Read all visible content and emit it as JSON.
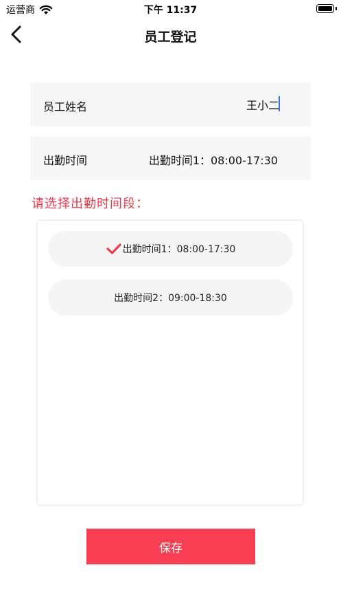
{
  "status_bar": {
    "carrier": "运营商",
    "time": "下午 11:37",
    "wifi_icon": "wifi-icon",
    "battery_icon": "battery-icon"
  },
  "nav": {
    "title": "员工登记",
    "back_icon": "chevron-left-icon"
  },
  "form": {
    "name_label": "员工姓名",
    "name_value": "王小二",
    "time_label": "出勤时间",
    "time_value": "出勤时间1：08:00-17:30"
  },
  "picker": {
    "prompt": "请选择出勤时间段：",
    "options": [
      {
        "label": "出勤时间1：08:00-17:30",
        "selected": true
      },
      {
        "label": "出勤时间2：09:00-18:30",
        "selected": false
      }
    ],
    "check_icon": "checkmark-icon"
  },
  "actions": {
    "save_label": "保存"
  },
  "colors": {
    "accent": "#f73e52",
    "prompt": "#f0394c",
    "row_bg": "#f7f7f7",
    "option_bg": "#f5f5f5",
    "caret": "#3a6fe0"
  }
}
